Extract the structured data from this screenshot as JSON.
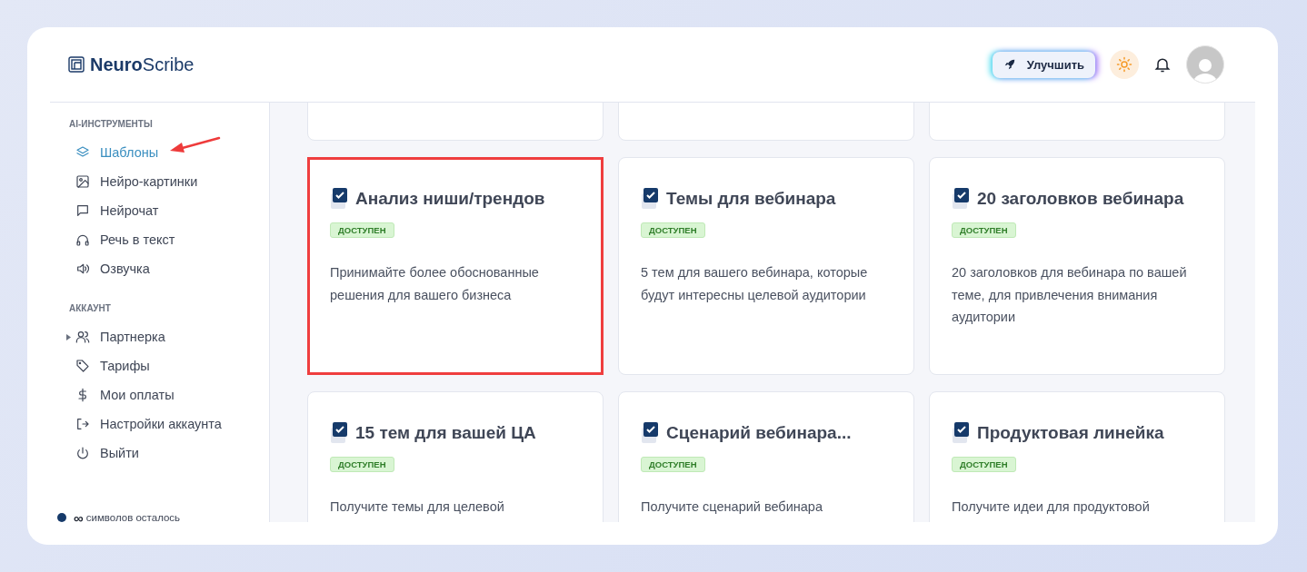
{
  "header": {
    "logo": {
      "bold": "Neuro",
      "rest": "Scribe"
    },
    "upgrade_button": "Улучшить"
  },
  "sidebar": {
    "sections": [
      {
        "title": "AI-ИНСТРУМЕНТЫ",
        "items": [
          {
            "label": "Шаблоны",
            "selected": true,
            "annotated": true
          },
          {
            "label": "Нейро-картинки",
            "selected": false,
            "annotated": false
          },
          {
            "label": "Нейрочат",
            "selected": false,
            "annotated": false
          },
          {
            "label": "Речь в текст",
            "selected": false,
            "annotated": false
          },
          {
            "label": "Озвучка",
            "selected": false,
            "annotated": false
          }
        ]
      },
      {
        "title": "АККАУНТ",
        "items": [
          {
            "label": "Партнерка",
            "selected": false,
            "annotated": false,
            "expanded": false
          },
          {
            "label": "Тарифы",
            "selected": false,
            "annotated": false
          },
          {
            "label": "Мои оплаты",
            "selected": false,
            "annotated": false
          },
          {
            "label": "Настройки аккаунта",
            "selected": false,
            "annotated": false
          },
          {
            "label": "Выйти",
            "selected": false,
            "annotated": false
          }
        ]
      }
    ],
    "footer": {
      "symbol": "∞",
      "text": "символов осталось"
    }
  },
  "cards": [
    {
      "title": "Анализ ниши/трендов",
      "badge": "ДОСТУПЕН",
      "description": "Принимайте более обоснованные решения для вашего бизнеса",
      "highlighted": true
    },
    {
      "title": "Темы для вебинара",
      "badge": "ДОСТУПЕН",
      "description": "5 тем для вашего вебинара, которые будут интересны целевой аудитории",
      "highlighted": false
    },
    {
      "title": "20 заголовков вебинара",
      "badge": "ДОСТУПЕН",
      "description": "20 заголовков для вебинара по вашей теме, для привлечения внимания аудитории",
      "highlighted": false
    },
    {
      "title": "15 тем для вашей ЦА",
      "badge": "ДОСТУПЕН",
      "description": "Получите темы для целевой",
      "highlighted": false
    },
    {
      "title": "Сценарий вебинара...",
      "badge": "ДОСТУПЕН",
      "description": "Получите сценарий вебинара",
      "highlighted": false
    },
    {
      "title": "Продуктовая линейка",
      "badge": "ДОСТУПЕН",
      "description": "Получите идеи для продуктовой",
      "highlighted": false
    }
  ]
}
